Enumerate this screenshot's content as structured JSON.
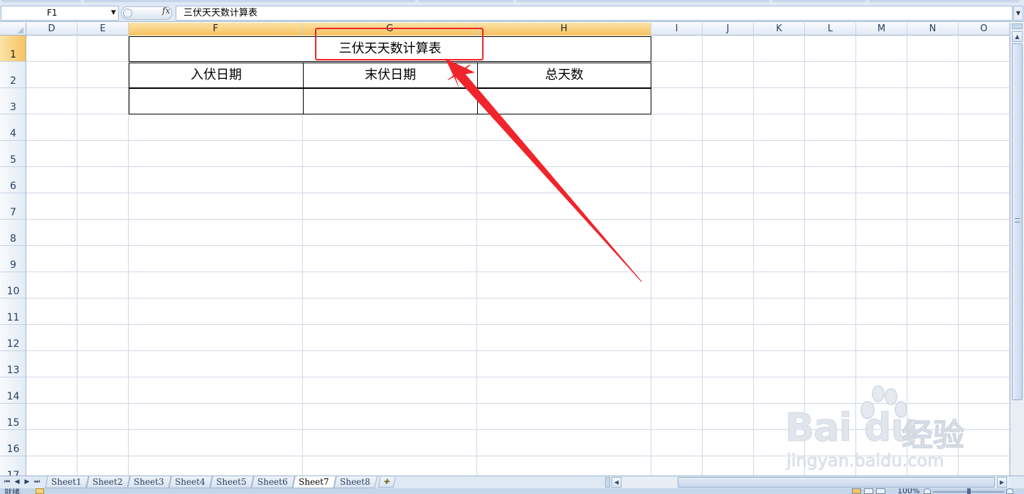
{
  "formula_bar": {
    "name_box": "F1",
    "fx_label": "fx",
    "formula": "三伏天天数计算表"
  },
  "columns": [
    "D",
    "E",
    "F",
    "G",
    "H",
    "I",
    "J",
    "K",
    "L",
    "M",
    "N",
    "O"
  ],
  "selected_columns": [
    "F",
    "G",
    "H"
  ],
  "rows": [
    "1",
    "2",
    "3",
    "4",
    "5",
    "6",
    "7",
    "8",
    "9",
    "10",
    "11",
    "12",
    "13",
    "14",
    "15",
    "16",
    "17"
  ],
  "selected_rows": [
    "1"
  ],
  "table": {
    "title": "三伏天天数计算表",
    "headers": [
      "入伏日期",
      "末伏日期",
      "总天数"
    ],
    "row3": [
      "",
      "",
      ""
    ]
  },
  "sheet_tabs": [
    "Sheet1",
    "Sheet2",
    "Sheet3",
    "Sheet4",
    "Sheet5",
    "Sheet6",
    "Sheet7",
    "Sheet8"
  ],
  "active_sheet": "Sheet7",
  "status_bar": {
    "ready_text": "就绪",
    "zoom": "100%"
  },
  "watermark": {
    "logo": "Bai du",
    "cn": "经验",
    "url": "jingyan.baidu.com"
  },
  "colors": {
    "annotation": "#f0242b",
    "selected_header": "#f7c25f",
    "grid_line": "#d0d7e5",
    "chrome": "#dfe8f5"
  },
  "icons": {
    "fx": "function-icon",
    "name_box_dropdown": "chevron-down-icon",
    "insert_sheet": "insert-sheet-icon"
  }
}
